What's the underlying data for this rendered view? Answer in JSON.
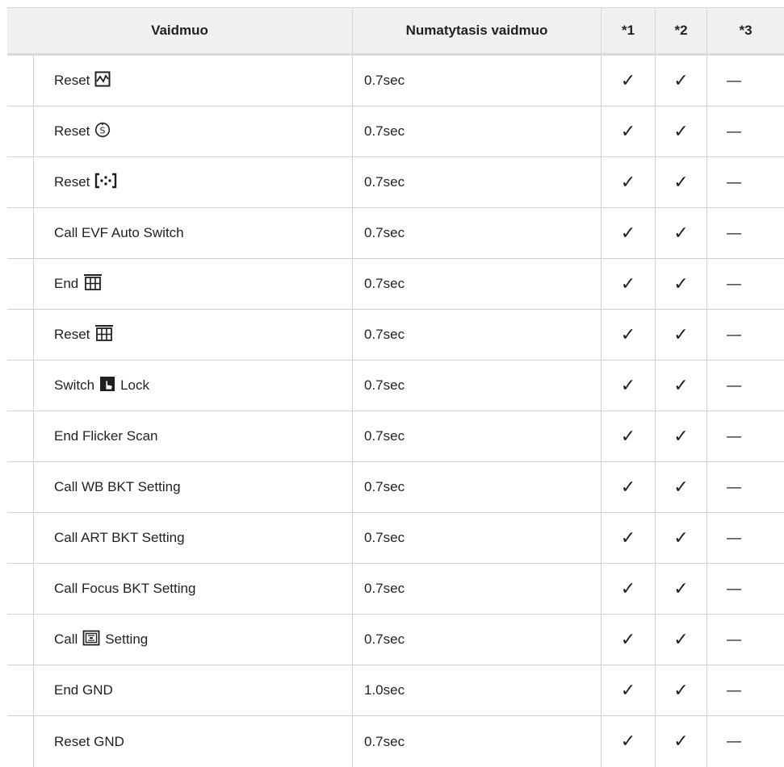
{
  "table": {
    "headers": {
      "action": "Vaidmuo",
      "default": "Numatytasis vaidmuo",
      "star1": "*1",
      "star2": "*2",
      "star3": "*3"
    },
    "rows": [
      {
        "prefix": "Reset",
        "icon": "histogram-icon",
        "suffix": "",
        "default": "0.7sec",
        "s1": "✓",
        "s2": "✓",
        "s3": "—"
      },
      {
        "prefix": "Reset",
        "icon": "self-timer-icon",
        "suffix": "",
        "default": "0.7sec",
        "s1": "✓",
        "s2": "✓",
        "s3": "—"
      },
      {
        "prefix": "Reset",
        "icon": "af-target-icon",
        "suffix": "",
        "default": "0.7sec",
        "s1": "✓",
        "s2": "✓",
        "s3": "—"
      },
      {
        "prefix": "Call EVF Auto Switch",
        "icon": "",
        "suffix": "",
        "default": "0.7sec",
        "s1": "✓",
        "s2": "✓",
        "s3": "—"
      },
      {
        "prefix": "End",
        "icon": "multi-exposure-grid-icon",
        "suffix": "",
        "default": "0.7sec",
        "s1": "✓",
        "s2": "✓",
        "s3": "—"
      },
      {
        "prefix": "Reset",
        "icon": "multi-exposure-grid-icon",
        "suffix": "",
        "default": "0.7sec",
        "s1": "✓",
        "s2": "✓",
        "s3": "—"
      },
      {
        "prefix": "Switch",
        "icon": "touch-lock-icon",
        "suffix": "Lock",
        "default": "0.7sec",
        "s1": "✓",
        "s2": "✓",
        "s3": "—"
      },
      {
        "prefix": "End Flicker Scan",
        "icon": "",
        "suffix": "",
        "default": "0.7sec",
        "s1": "✓",
        "s2": "✓",
        "s3": "—"
      },
      {
        "prefix": "Call WB BKT Setting",
        "icon": "",
        "suffix": "",
        "default": "0.7sec",
        "s1": "✓",
        "s2": "✓",
        "s3": "—"
      },
      {
        "prefix": "Call ART BKT Setting",
        "icon": "",
        "suffix": "",
        "default": "0.7sec",
        "s1": "✓",
        "s2": "✓",
        "s3": "—"
      },
      {
        "prefix": "Call Focus BKT Setting",
        "icon": "",
        "suffix": "",
        "default": "0.7sec",
        "s1": "✓",
        "s2": "✓",
        "s3": "—"
      },
      {
        "prefix": "Call",
        "icon": "frame-preview-icon",
        "suffix": "Setting",
        "default": "0.7sec",
        "s1": "✓",
        "s2": "✓",
        "s3": "—"
      },
      {
        "prefix": "End GND",
        "icon": "",
        "suffix": "",
        "default": "1.0sec",
        "s1": "✓",
        "s2": "✓",
        "s3": "—"
      },
      {
        "prefix": "Reset GND",
        "icon": "",
        "suffix": "",
        "default": "0.7sec",
        "s1": "✓",
        "s2": "✓",
        "s3": "—"
      }
    ]
  }
}
